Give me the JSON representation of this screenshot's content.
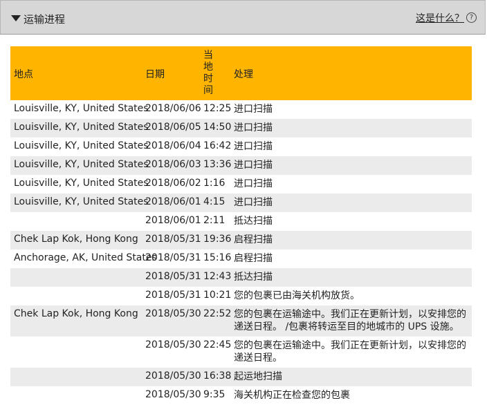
{
  "header": {
    "title": "运输进程",
    "help_link": "这是什么？",
    "help_icon": "?"
  },
  "table": {
    "columns": [
      "地点",
      "日期",
      "当地时间",
      "处理"
    ],
    "time_header_chars": [
      "当",
      "地",
      "时",
      "间"
    ],
    "rows": [
      {
        "location": "Louisville, KY, United States",
        "date": "2018/06/06",
        "time": "12:25",
        "activity": "进口扫描"
      },
      {
        "location": "Louisville, KY, United States",
        "date": "2018/06/05",
        "time": "14:50",
        "activity": "进口扫描"
      },
      {
        "location": "Louisville, KY, United States",
        "date": "2018/06/04",
        "time": "16:42",
        "activity": "进口扫描"
      },
      {
        "location": "Louisville, KY, United States",
        "date": "2018/06/03",
        "time": "13:36",
        "activity": "进口扫描"
      },
      {
        "location": "Louisville, KY, United States",
        "date": "2018/06/02",
        "time": "1:16",
        "activity": "进口扫描"
      },
      {
        "location": "Louisville, KY, United States",
        "date": "2018/06/01",
        "time": "4:15",
        "activity": "进口扫描"
      },
      {
        "location": "",
        "date": "2018/06/01",
        "time": "2:11",
        "activity": "抵达扫描"
      },
      {
        "location": "Chek Lap Kok, Hong Kong",
        "date": "2018/05/31",
        "time": "19:36",
        "activity": "启程扫描"
      },
      {
        "location": "Anchorage, AK, United States",
        "date": "2018/05/31",
        "time": "15:16",
        "activity": "启程扫描"
      },
      {
        "location": "",
        "date": "2018/05/31",
        "time": "12:43",
        "activity": "抵达扫描"
      },
      {
        "location": "",
        "date": "2018/05/31",
        "time": "10:21",
        "activity": "您的包裹已由海关机构放货。"
      },
      {
        "location": "Chek Lap Kok, Hong Kong",
        "date": "2018/05/30",
        "time": "22:52",
        "activity": "您的包裹在运输途中。我们正在更新计划，以安排您的递送日程。 /包裹将转运至目的地城市的 UPS 设施。"
      },
      {
        "location": "",
        "date": "2018/05/30",
        "time": "22:45",
        "activity": "您的包裹在运输途中。我们正在更新计划，以安排您的递送日程。"
      },
      {
        "location": "",
        "date": "2018/05/30",
        "time": "16:38",
        "activity": "起运地扫描"
      },
      {
        "location": "",
        "date": "2018/05/30",
        "time": "9:35",
        "activity": "海关机构正在检查您的包裹"
      }
    ]
  },
  "colors": {
    "header_bg": "#d7d7d7",
    "table_header_bg": "#ffb400",
    "alt_row_bg": "#ebebeb"
  }
}
